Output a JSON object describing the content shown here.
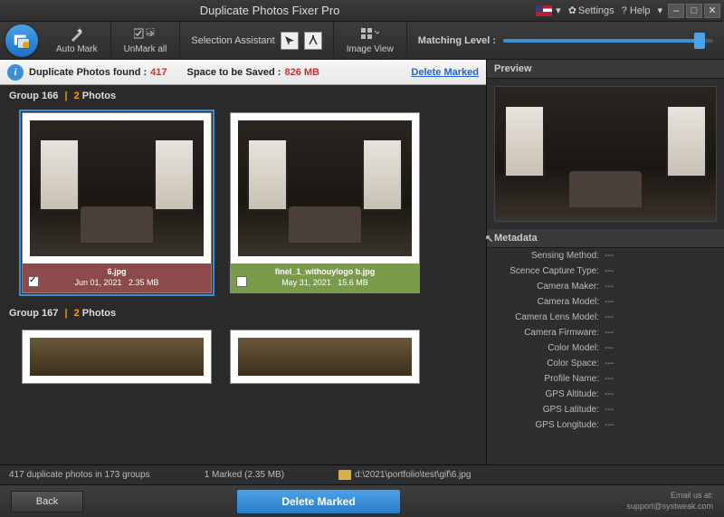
{
  "title": "Duplicate Photos Fixer Pro",
  "titlebar": {
    "settings": "Settings",
    "help": "? Help"
  },
  "toolbar": {
    "automark": "Auto Mark",
    "unmarkall": "UnMark all",
    "selection_assistant": "Selection Assistant",
    "image_view": "Image View",
    "matching_level": "Matching Level :"
  },
  "info": {
    "found_label": "Duplicate Photos found :",
    "found_value": "417",
    "space_label": "Space to be Saved :",
    "space_value": "826 MB",
    "delete_marked": "Delete Marked"
  },
  "groups": [
    {
      "id": "166",
      "label": "Group 166",
      "sep": "|",
      "count": "2",
      "count_suffix": " Photos",
      "photos": [
        {
          "filename": "6.jpg",
          "date": "Jun 01, 2021",
          "size": "2.35 MB",
          "selected": true,
          "checked": true,
          "footer": "red"
        },
        {
          "filename": "finel_1_withouylogo b.jpg",
          "date": "May 31, 2021",
          "size": "15.6 MB",
          "selected": false,
          "checked": false,
          "footer": "green"
        }
      ]
    },
    {
      "id": "167",
      "label": "Group 167",
      "sep": "|",
      "count": "2",
      "count_suffix": " Photos",
      "photos": [
        {
          "filename": "",
          "date": "",
          "size": "",
          "selected": false,
          "checked": false,
          "footer": "none"
        },
        {
          "filename": "",
          "date": "",
          "size": "",
          "selected": false,
          "checked": false,
          "footer": "none"
        }
      ]
    }
  ],
  "right": {
    "preview_label": "Preview",
    "metadata_label": "Metadata",
    "rows": [
      {
        "k": "Sensing Method:",
        "v": "---"
      },
      {
        "k": "Scence Capture Type:",
        "v": "---"
      },
      {
        "k": "Camera Maker:",
        "v": "---"
      },
      {
        "k": "Camera Model:",
        "v": "---"
      },
      {
        "k": "Camera Lens Model:",
        "v": "---"
      },
      {
        "k": "Camera Firmware:",
        "v": "---"
      },
      {
        "k": "Color Model:",
        "v": "---"
      },
      {
        "k": "Color Space:",
        "v": "---"
      },
      {
        "k": "Profile Name:",
        "v": "---"
      },
      {
        "k": "GPS Altitude:",
        "v": "---"
      },
      {
        "k": "GPS Latitude:",
        "v": "---"
      },
      {
        "k": "GPS Longitude:",
        "v": "---"
      }
    ]
  },
  "status": {
    "summary": "417 duplicate photos in 173 groups",
    "marked": "1 Marked (2.35 MB)",
    "path": "d:\\2021\\portfolio\\test\\gif\\6.jpg"
  },
  "bottom": {
    "back": "Back",
    "delete": "Delete Marked",
    "email_label": "Email us at:",
    "email": "support@systweak.com"
  }
}
